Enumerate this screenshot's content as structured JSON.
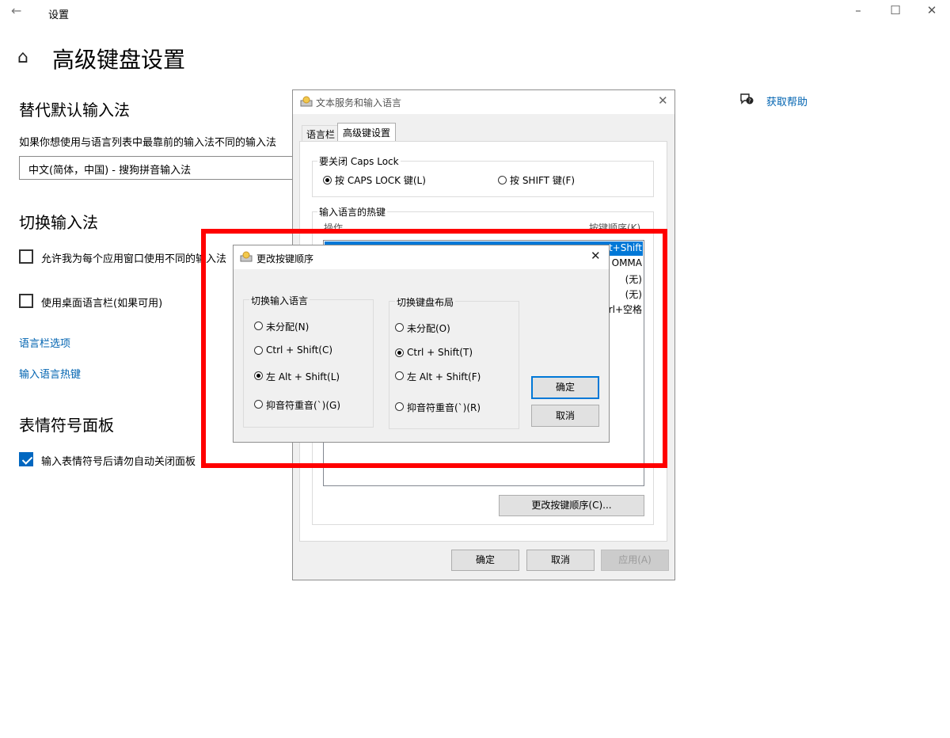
{
  "settings": {
    "window_title": "设置",
    "page_title": "高级键盘设置",
    "section1_title": "替代默认输入法",
    "section1_desc": "如果你想使用与语言列表中最靠前的输入法不同的输入法",
    "combo_value": "中文(简体，中国) - 搜狗拼音输入法",
    "section2_title": "切换输入法",
    "checkbox1_label": "允许我为每个应用窗口使用不同的输入法",
    "checkbox2_label": "使用桌面语言栏(如果可用)",
    "link1": "语言栏选项",
    "link2": "输入语言热键",
    "section3_title": "表情符号面板",
    "checkbox3_label": "输入表情符号后请勿自动关闭面板",
    "help_text": "获取帮助"
  },
  "dialog1": {
    "title": "文本服务和输入语言",
    "tabs": [
      "语言栏",
      "高级键设置"
    ],
    "caps_group_label": "要关闭 Caps Lock",
    "caps_option1": "按 CAPS LOCK 键(L)",
    "caps_option2": "按 SHIFT 键(F)",
    "hotkey_group_label": "输入语言的热键",
    "list_header_left": "操作",
    "list_header_right": "按键顺序(K)",
    "list_rows": [
      "t+Shift",
      "OMMA",
      "(无)",
      "(无)",
      "rl+空格"
    ],
    "change_button": "更改按键顺序(C)...",
    "ok": "确定",
    "cancel": "取消",
    "apply": "应用(A)"
  },
  "dialog2": {
    "title": "更改按键顺序",
    "group1_label": "切换输入语言",
    "group1_options": [
      "未分配(N)",
      "Ctrl + Shift(C)",
      "左 Alt + Shift(L)",
      "抑音符重音(`)(G)"
    ],
    "group2_label": "切换键盘布局",
    "group2_options": [
      "未分配(O)",
      "Ctrl + Shift(T)",
      "左 Alt + Shift(F)",
      "抑音符重音(`)(R)"
    ],
    "ok": "确定",
    "cancel": "取消"
  },
  "colors": {
    "accent": "#0078d7",
    "link": "#0063b1",
    "highlight": "#ff0000"
  }
}
